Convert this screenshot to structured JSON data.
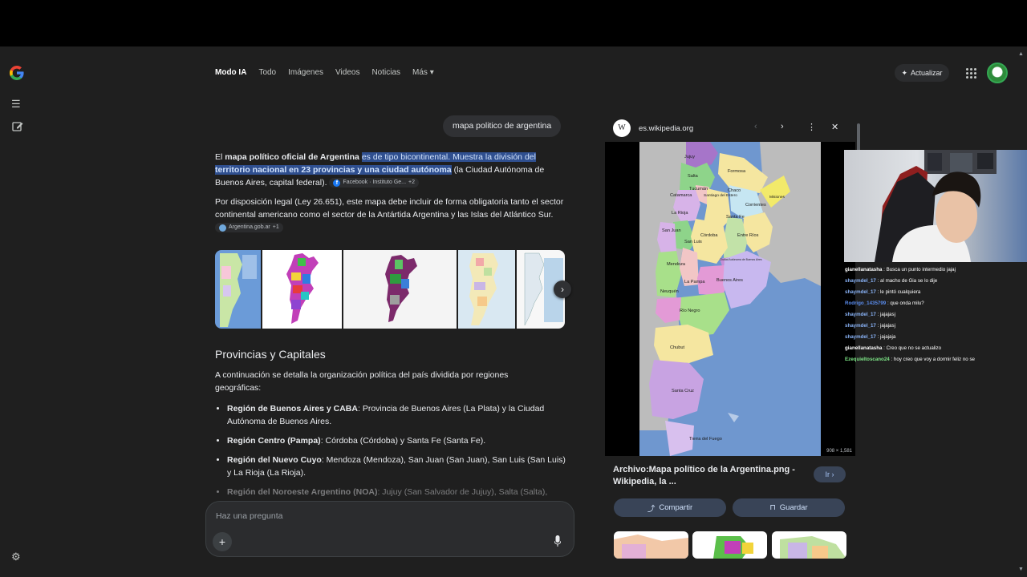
{
  "nav": {
    "tabs": [
      {
        "label": "Modo IA",
        "active": true
      },
      {
        "label": "Todo"
      },
      {
        "label": "Imágenes"
      },
      {
        "label": "Videos"
      },
      {
        "label": "Noticias"
      },
      {
        "label": "Más ▾"
      }
    ],
    "update_label": "Actualizar"
  },
  "query": "mapa politico de argentina",
  "answer": {
    "p1_a": "El ",
    "p1_b": "mapa político oficial de Argentina",
    "p1_c": "es de tipo bicontinental. Muestra la división del ",
    "p1_d": "territorio nacional en 23 provincias y una ciudad autónoma",
    "p1_e": " (la Ciudad Autónoma de Buenos Aires, capital federal).",
    "p1_source": "Facebook · Instituto Ge...",
    "p1_source_more": "+2",
    "p2": "Por disposición legal (Ley 26.651), este mapa debe incluir de forma obligatoria tanto el sector continental americano como el sector de la Antártida Argentina y las Islas del Atlántico Sur.",
    "p2_source": "Argentina.gob.ar",
    "p2_source_more": "+1"
  },
  "section": {
    "title": "Provincias y Capitales",
    "intro": "A continuación se detalla la organización política del país dividida por regiones geográficas:",
    "items": [
      {
        "bold": "Región de Buenos Aires y CABA",
        "text": ": Provincia de Buenos Aires (La Plata) y la Ciudad Autónoma de Buenos Aires."
      },
      {
        "bold": "Región Centro (Pampa)",
        "text": ": Córdoba (Córdoba) y Santa Fe (Santa Fe)."
      },
      {
        "bold": "Región del Nuevo Cuyo",
        "text": ": Mendoza (Mendoza), San Juan (San Juan), San Luis (San Luis) y La Rioja (La Rioja)."
      },
      {
        "bold": "Región del Noroeste Argentino (NOA)",
        "text": ": Jujuy (San Salvador de Jujuy), Salta (Salta),"
      }
    ]
  },
  "ask": {
    "placeholder": "Haz una pregunta",
    "plus": "+"
  },
  "panel": {
    "source": "es.wikipedia.org",
    "dims": "908 × 1,581",
    "title": "Archivo:Mapa político de la Argentina.png - Wikipedia, la ...",
    "go_label": "Ir ›",
    "share_label": "Compartir",
    "save_label": "Guardar",
    "map_labels": {
      "jujuy": "Jujuy",
      "salta": "Salta",
      "formosa": "Formosa",
      "tucuman": "Tucumán",
      "chaco": "Chaco",
      "catamarca": "Catamarca",
      "santiago": "Santiago del Estero",
      "misiones": "Misiones",
      "corrientes": "Corrientes",
      "larioja": "La Rioja",
      "santafe": "Santa Fe",
      "sanjuan": "San Juan",
      "cordoba": "Córdoba",
      "entrerios": "Entre Ríos",
      "sanluis": "San Luis",
      "mendoza": "Mendoza",
      "caba": "Ciudad Autónoma de Buenos Aires",
      "lapampa": "La Pampa",
      "buenosaires": "Buenos Aires",
      "neuquen": "Neuquén",
      "rionegro": "Río Negro",
      "chubut": "Chubut",
      "santacruz": "Santa Cruz",
      "tierradelfuego": "Tierra del Fuego"
    }
  },
  "chat": [
    {
      "name": "gianellanatasha",
      "color": "#ffffff",
      "msg": ": Busca un punto intermedio jajaj"
    },
    {
      "name": "shaymdel_17",
      "color": "#8ab4f8",
      "msg": ": al macho de Gia se lo dije"
    },
    {
      "name": "shaymdel_17",
      "color": "#8ab4f8",
      "msg": ": le pintó cualquiera"
    },
    {
      "name": "Rodrigo_1435799",
      "color": "#5b8def",
      "msg": ": que onda milu?"
    },
    {
      "name": "shaymdel_17",
      "color": "#8ab4f8",
      "msg": ": jajajasj"
    },
    {
      "name": "shaymdel_17",
      "color": "#8ab4f8",
      "msg": ": jajajasj"
    },
    {
      "name": "shaymdel_17",
      "color": "#8ab4f8",
      "msg": ": jajajaja"
    },
    {
      "name": "gianellanatasha",
      "color": "#ffffff",
      "msg": ": Creo que no se actualizo"
    },
    {
      "name": "Ezequieltoscano24",
      "color": "#7ee787",
      "msg": ": hoy creo que voy a dormir feliz no se"
    }
  ]
}
